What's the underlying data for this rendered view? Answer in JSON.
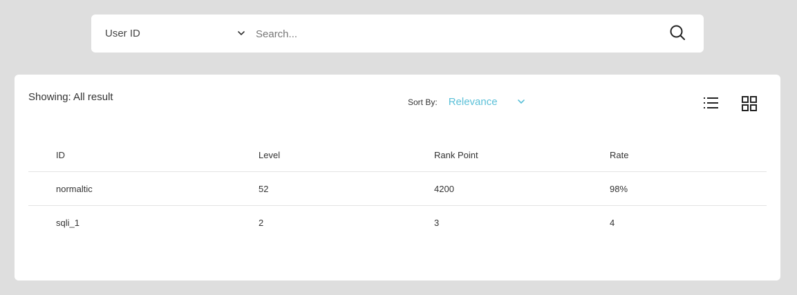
{
  "search": {
    "filter_label": "User ID",
    "placeholder": "Search...",
    "value": ""
  },
  "results": {
    "showing": "Showing: All result",
    "sort_label": "Sort By:",
    "sort_value": "Relevance",
    "columns": {
      "id": "ID",
      "level": "Level",
      "rank_point": "Rank Point",
      "rate": "Rate"
    },
    "rows": [
      {
        "id": "normaltic",
        "level": "52",
        "rank_point": "4200",
        "rate": "98%"
      },
      {
        "id": "sqli_1",
        "level": "2",
        "rank_point": "3",
        "rate": "4"
      }
    ]
  },
  "colors": {
    "background": "#dedede",
    "accent": "#5bc0d8",
    "divider": "#e3e3e3"
  },
  "icons": {
    "filter_chevron": "chevron-down-icon",
    "search": "search-icon",
    "sort_chevron": "chevron-down-icon",
    "list_view": "list-view-icon",
    "grid_view": "grid-view-icon"
  }
}
